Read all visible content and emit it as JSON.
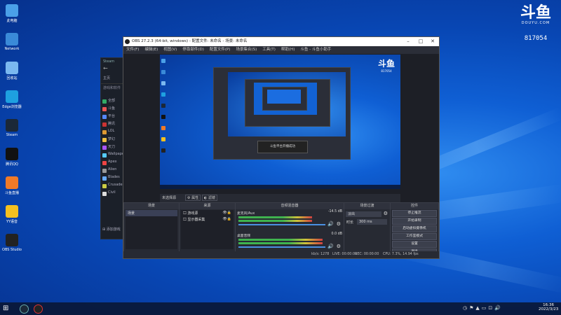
{
  "desktop": {
    "icons": [
      {
        "label": "此电脑",
        "icon": "computer-icon",
        "color": "#4aa0e8"
      },
      {
        "label": "Network",
        "icon": "network-icon",
        "color": "#3a8ad8"
      },
      {
        "label": "回收站",
        "icon": "recycle-bin-icon",
        "color": "#7ab8f0"
      },
      {
        "label": "Edge浏览器",
        "icon": "edge-icon",
        "color": "#1ea0e0"
      },
      {
        "label": "Steam",
        "icon": "steam-icon",
        "color": "#1b2838"
      },
      {
        "label": "腾讯QQ",
        "icon": "qq-icon",
        "color": "#111"
      },
      {
        "label": "斗鱼直播",
        "icon": "douyu-icon",
        "color": "#f07a28"
      },
      {
        "label": "YY语音",
        "icon": "yy-icon",
        "color": "#f4c020"
      },
      {
        "label": "OBS Studio",
        "icon": "obs-icon",
        "color": "#222"
      }
    ]
  },
  "watermark": {
    "brand": "斗鱼",
    "sub": "DOUYU.COM",
    "room": "817054"
  },
  "steam": {
    "title": "Steam",
    "nav": "主页",
    "library": "游戏和软件",
    "items": [
      "全部",
      "斗鱼",
      "平台",
      "腾讯",
      "LOL",
      "梦幻",
      "天刀",
      "Wallpaper",
      "Apex",
      "Alien",
      "Blades",
      "Crusader",
      "Civil"
    ],
    "add": "添加游戏"
  },
  "obs": {
    "title": "OBS 27.2.3 (64-bit, windows) - 配置文件: 未命名 - 场景: 未命名",
    "menu": [
      "文件(F)",
      "编辑(E)",
      "视图(V)",
      "停靠部件(D)",
      "配置文件(P)",
      "场景集合(S)",
      "工具(T)",
      "帮助(H)",
      "斗鱼 - 斗鱼小助手"
    ],
    "toolbar": {
      "properties": "属性",
      "filters": "滤镜"
    },
    "source_label": "未选择源",
    "scenes": {
      "header": "场景",
      "items": [
        "场景"
      ]
    },
    "sources": {
      "header": "来源",
      "items": [
        "游戏源",
        "显示器采集"
      ]
    },
    "mixer": {
      "header": "音频混音器",
      "channels": [
        {
          "name": "麦克风/Aux",
          "db": "-14.5 dB",
          "level": 0.72
        },
        {
          "name": "桌面音频",
          "db": "0.0 dB",
          "level": 0.82
        }
      ]
    },
    "transitions": {
      "header": "场景过渡",
      "type": "淡出",
      "duration_label": "时长",
      "duration": "300 ms"
    },
    "controls": {
      "header": "控件",
      "buttons": [
        "停止推流",
        "开始录制",
        "启动虚拟摄像机",
        "工作室模式",
        "设置",
        "退出"
      ]
    },
    "status": {
      "live": "LIVE: 00:00:00",
      "rec": "REC: 00:00:00",
      "cpu": "CPU: 7.3%, 14.94 fps",
      "kbps": "kb/s: 1278"
    },
    "overlay": "斗鱼平台开播成功"
  },
  "taskbar": {
    "time": "16:36",
    "date": "2022/3/23"
  }
}
